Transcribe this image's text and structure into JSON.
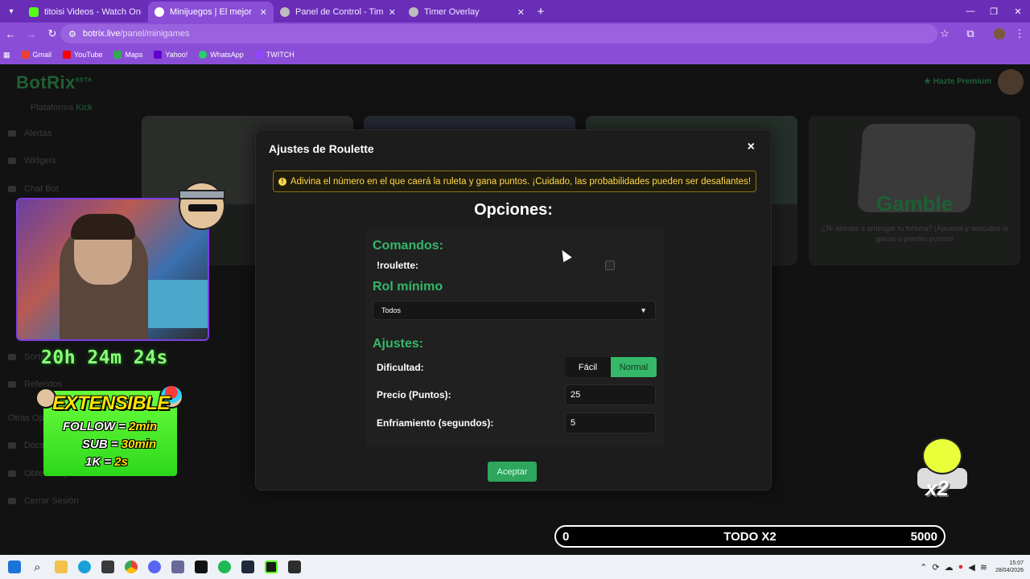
{
  "browser": {
    "tabs": [
      {
        "title": "titoisi Videos - Watch On-Dem",
        "favicon_color": "#53fc18",
        "active": false
      },
      {
        "title": "Minijuegos | El mejor software",
        "favicon_color": "#ffffff",
        "active": true
      },
      {
        "title": "Panel de Control - Timer",
        "favicon_color": "#bdbdbd",
        "active": false
      },
      {
        "title": "Timer Overlay",
        "favicon_color": "#bdbdbd",
        "active": false
      }
    ],
    "url_host": "botrix.live",
    "url_path": "/panel/minigames",
    "bookmarks": [
      {
        "label": "Gmail",
        "color": "#ea4335"
      },
      {
        "label": "YouTube",
        "color": "#ff0000"
      },
      {
        "label": "Maps",
        "color": "#34a853"
      },
      {
        "label": "Yahoo!",
        "color": "#6001d2"
      },
      {
        "label": "WhatsApp",
        "color": "#25d366"
      },
      {
        "label": "TWITCH",
        "color": "#9146ff"
      }
    ]
  },
  "page": {
    "logo": "BotRix",
    "logo_badge": "BETA",
    "platform_label": "Plataforma",
    "platform_value": "Kick",
    "sidebar": [
      "Alertas",
      "Widgets",
      "Chat Bot",
      "Sorteos",
      "Referidos",
      "Otras Opc.",
      "Docs",
      "Obtener Ayuda",
      "Cerrar Sesión"
    ],
    "premium": "Hazte Premium",
    "gamble_title": "Gamble",
    "gamble_desc": "¿Te atreves a arriesgar tu fortuna? ¡Apuesta y descubre si ganas o pierdes puntos!"
  },
  "modal": {
    "title": "Ajustes de Roulette",
    "close": "×",
    "alert": "Adivina el número en el que caerá la ruleta y gana puntos. ¡Cuidado, las probabilidades pueden ser desafiantes!",
    "options_title": "Opciones:",
    "commands_heading": "Comandos:",
    "command": "!roulette:",
    "role_heading": "Rol mínimo",
    "role_value": "Todos",
    "settings_heading": "Ajustes:",
    "difficulty_label": "Dificultad:",
    "difficulty_options": [
      "Fácil",
      "Normal"
    ],
    "difficulty_selected": "Normal",
    "price_label": "Precio (Puntos):",
    "price_value": "25",
    "cooldown_label": "Enfriamiento (segundos):",
    "cooldown_value": "5",
    "accept": "Aceptar"
  },
  "overlay": {
    "timer": "20h 24m 24s",
    "extensible_title": "EXTENSIBLE",
    "rules": [
      {
        "left": "FOLLOW =",
        "right": "2min"
      },
      {
        "left": "SUB =",
        "right": "30min"
      },
      {
        "left": "1K =",
        "right": "2s"
      }
    ],
    "x2_label": "x2",
    "bar_left": "0",
    "bar_mid": "TODO X2",
    "bar_right": "5000"
  },
  "taskbar": {
    "time": "15:07",
    "date": "28/04/2026"
  }
}
